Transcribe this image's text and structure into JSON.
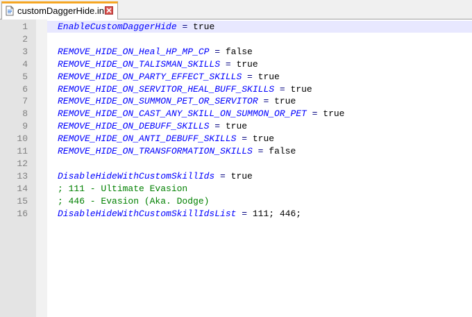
{
  "tab": {
    "title": "customDaggerHide.ini"
  },
  "colors": {
    "key": "#0000ff",
    "comment": "#008000",
    "operator": "#000080",
    "tab_accent": "#f5a623"
  },
  "lines": [
    {
      "num": "1",
      "type": "kv",
      "key": "EnableCustomDaggerHide",
      "op": " = ",
      "value": "true"
    },
    {
      "num": "2",
      "type": "blank"
    },
    {
      "num": "3",
      "type": "kv",
      "key": "REMOVE_HIDE_ON_Heal_HP_MP_CP",
      "op": " = ",
      "value": "false"
    },
    {
      "num": "4",
      "type": "kv",
      "key": "REMOVE_HIDE_ON_TALISMAN_SKILLS",
      "op": " = ",
      "value": "true"
    },
    {
      "num": "5",
      "type": "kv",
      "key": "REMOVE_HIDE_ON_PARTY_EFFECT_SKILLS",
      "op": " = ",
      "value": "true"
    },
    {
      "num": "6",
      "type": "kv",
      "key": "REMOVE_HIDE_ON_SERVITOR_HEAL_BUFF_SKILLS",
      "op": " = ",
      "value": "true"
    },
    {
      "num": "7",
      "type": "kv",
      "key": "REMOVE_HIDE_ON_SUMMON_PET_OR_SERVITOR",
      "op": " = ",
      "value": "true"
    },
    {
      "num": "8",
      "type": "kv",
      "key": "REMOVE_HIDE_ON_CAST_ANY_SKILL_ON_SUMMON_OR_PET",
      "op": " = ",
      "value": "true"
    },
    {
      "num": "9",
      "type": "kv",
      "key": "REMOVE_HIDE_ON_DEBUFF_SKILLS",
      "op": " = ",
      "value": "true"
    },
    {
      "num": "10",
      "type": "kv",
      "key": "REMOVE_HIDE_ON_ANTI_DEBUFF_SKILLS",
      "op": " = ",
      "value": "true"
    },
    {
      "num": "11",
      "type": "kv",
      "key": "REMOVE_HIDE_ON_TRANSFORMATION_SKILLS",
      "op": " = ",
      "value": "false"
    },
    {
      "num": "12",
      "type": "blank"
    },
    {
      "num": "13",
      "type": "kv",
      "key": "DisableHideWithCustomSkillIds",
      "op": " = ",
      "value": "true"
    },
    {
      "num": "14",
      "type": "comment",
      "text": "; 111 - Ultimate Evasion"
    },
    {
      "num": "15",
      "type": "comment",
      "text": "; 446 - Evasion (Aka. Dodge)"
    },
    {
      "num": "16",
      "type": "kv",
      "key": "DisableHideWithCustomSkillIdsList",
      "op": " = ",
      "value": "111; 446;"
    }
  ]
}
